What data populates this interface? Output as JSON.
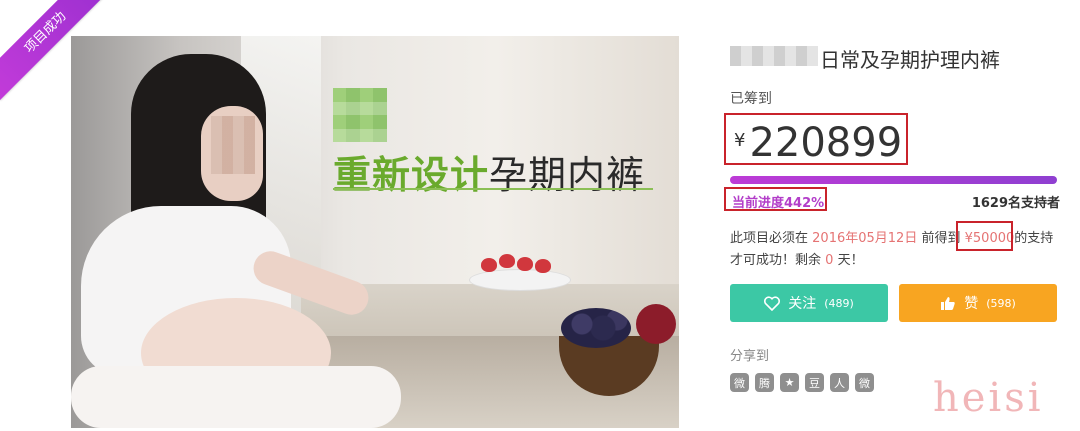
{
  "badge": "项目成功",
  "hero": {
    "headline_green": "重新设计",
    "headline_black": "孕期内裤"
  },
  "project": {
    "title": "日常及孕期护理内裤",
    "raised_label": "已筹到",
    "currency": "¥",
    "amount": "220899",
    "progress_percent": 442,
    "progress_text": "当前进度442%",
    "supporters_text": "1629名支持者",
    "desc_prefix": "此项目必须在",
    "deadline": "2016年05月12日",
    "desc_mid": "前得到",
    "goal": "¥50000",
    "desc_suffix": "的支持才可成功！剩余",
    "remaining_days": "0",
    "desc_end": "天！"
  },
  "actions": {
    "follow_label": "关注",
    "follow_count": "(489)",
    "like_label": "赞",
    "like_count": "(598)"
  },
  "share": {
    "label": "分享到",
    "icons": [
      "weibo-icon",
      "tencent-weibo-icon",
      "qzone-icon",
      "douban-icon",
      "renren-icon",
      "wechat-icon"
    ],
    "glyphs": [
      "微",
      "腾",
      "★",
      "豆",
      "人",
      "微"
    ]
  },
  "watermark": "heisi",
  "colors": {
    "accent_purple": "#b33ec9",
    "follow_green": "#3cc8a5",
    "like_orange": "#f8a521",
    "highlight_red": "#c9232b"
  }
}
